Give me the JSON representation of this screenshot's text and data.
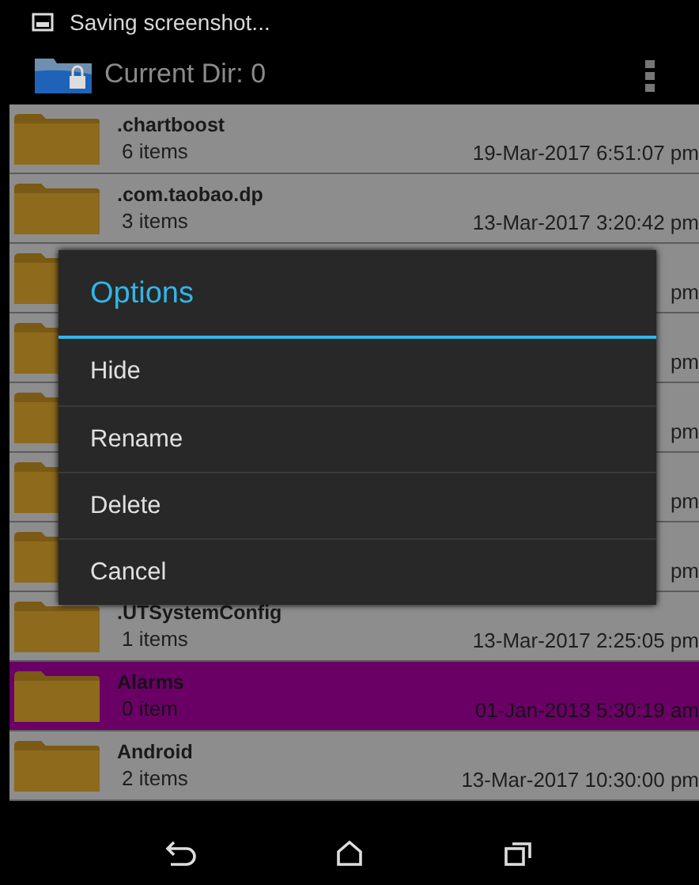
{
  "status_bar": {
    "notification": "Saving screenshot..."
  },
  "action_bar": {
    "title": "Current Dir: 0"
  },
  "files": [
    {
      "name": ".chartboost",
      "count": "6 items",
      "date": "19-Mar-2017 6:51:07 pm",
      "selected": false
    },
    {
      "name": ".com.taobao.dp",
      "count": "3 items",
      "date": "13-Mar-2017 3:20:42 pm",
      "selected": false
    },
    {
      "date": "pm",
      "selected": false
    },
    {
      "date": "pm",
      "selected": false
    },
    {
      "date": "pm",
      "selected": false
    },
    {
      "date": "pm",
      "selected": false
    },
    {
      "date": "pm",
      "selected": false
    },
    {
      "name": ".UTSystemConfig",
      "count": "1 items",
      "date": "13-Mar-2017 2:25:05 pm",
      "selected": false
    },
    {
      "name": "Alarms",
      "count": "0 item",
      "date": "01-Jan-2013 5:30:19 am",
      "selected": true
    },
    {
      "name": "Android",
      "count": "2 items",
      "date": "13-Mar-2017 10:30:00 pm",
      "selected": false
    }
  ],
  "dialog": {
    "title": "Options",
    "items": [
      "Hide",
      "Rename",
      "Delete",
      "Cancel"
    ]
  }
}
